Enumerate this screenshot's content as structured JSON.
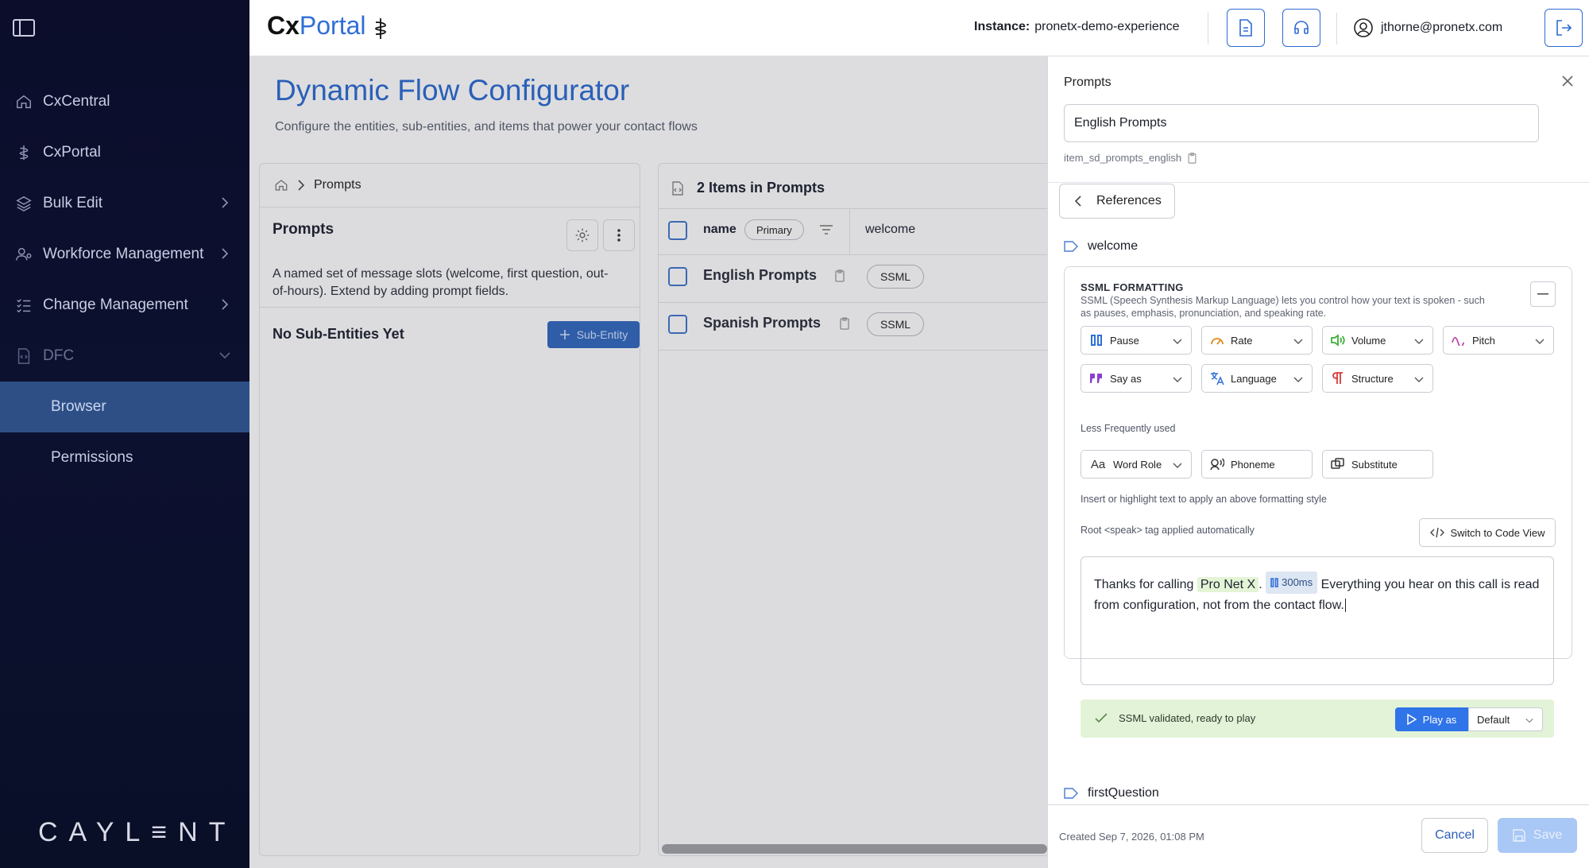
{
  "sidebar": {
    "items": [
      {
        "label": "CxCentral",
        "icon": "home-icon"
      },
      {
        "label": "CxPortal",
        "icon": "portal-icon"
      },
      {
        "label": "Bulk Edit",
        "icon": "layers-icon"
      },
      {
        "label": "Workforce Management",
        "icon": "users-icon"
      },
      {
        "label": "Change Management",
        "icon": "checklist-icon"
      },
      {
        "label": "DFC",
        "icon": "code-file-icon"
      }
    ],
    "sub_items": [
      {
        "label": "Browser",
        "active": true
      },
      {
        "label": "Permissions",
        "active": false
      }
    ],
    "brand": "CAYL≡NT"
  },
  "header": {
    "logo_cx": "Cx",
    "logo_portal": "Portal",
    "instance_label": "Instance:",
    "instance_value": "pronetx-demo-experience",
    "user_email": "jthorne@pronetx.com"
  },
  "main": {
    "title": "Dynamic Flow Configurator",
    "subtitle": "Configure the entities, sub-entities, and items that power your contact flows",
    "entity": {
      "breadcrumb": "Prompts",
      "title": "Prompts",
      "description": "A named set of message slots (welcome, first question, out-of-hours). Extend by adding prompt fields.",
      "no_sub": "No Sub-Entities Yet",
      "add_sub_label": "Sub-Entity"
    },
    "items": {
      "title": "2 Items in Prompts",
      "col_name": "name",
      "col_primary": "Primary",
      "col_welcome": "welcome",
      "rows": [
        {
          "name": "English Prompts",
          "welcome": "SSML"
        },
        {
          "name": "Spanish Prompts",
          "welcome": "SSML"
        }
      ]
    }
  },
  "panel": {
    "label": "Prompts",
    "name_value": "English Prompts",
    "item_id": "item_sd_prompts_english",
    "references_label": "References",
    "slot1": "welcome",
    "slot2": "firstQuestion",
    "ssml": {
      "heading": "SSML FORMATTING",
      "description": "SSML (Speech Synthesis Markup Language) lets you control how your text is spoken - such as pauses, emphasis, pronunciation, and speaking rate.",
      "tools": [
        {
          "label": "Pause",
          "icon": "pause-icon",
          "color": "#2f6fd6"
        },
        {
          "label": "Rate",
          "icon": "gauge-icon",
          "color": "#e08a1e"
        },
        {
          "label": "Volume",
          "icon": "volume-icon",
          "color": "#3fae3a"
        },
        {
          "label": "Pitch",
          "icon": "wave-icon",
          "color": "#c02fa3"
        },
        {
          "label": "Say as",
          "icon": "quote-icon",
          "color": "#8a3fd1"
        },
        {
          "label": "Language",
          "icon": "translate-icon",
          "color": "#2f6fd6"
        },
        {
          "label": "Structure",
          "icon": "paragraph-icon",
          "color": "#d83a3a"
        }
      ],
      "less_label": "Less Frequently used",
      "less_tools": [
        {
          "label": "Word Role",
          "icon": "text-icon"
        },
        {
          "label": "Phoneme",
          "icon": "speaker-icon"
        },
        {
          "label": "Substitute",
          "icon": "swap-icon"
        }
      ],
      "hint": "Insert or highlight text to apply an above formatting style",
      "root_note": "Root <speak> tag applied automatically",
      "code_view": "Switch to Code View",
      "text_before": "Thanks for calling ",
      "text_highlight": "Pro Net X",
      "text_period": ".",
      "break_label": "300ms",
      "text_after": "Everything you hear on this call is read from configuration, not from the contact flow.",
      "validated": "SSML validated, ready to play",
      "play_label": "Play as",
      "voice": "Default"
    },
    "footer": {
      "created": "Created Sep 7, 2026, 01:08 PM",
      "cancel": "Cancel",
      "save": "Save"
    }
  }
}
